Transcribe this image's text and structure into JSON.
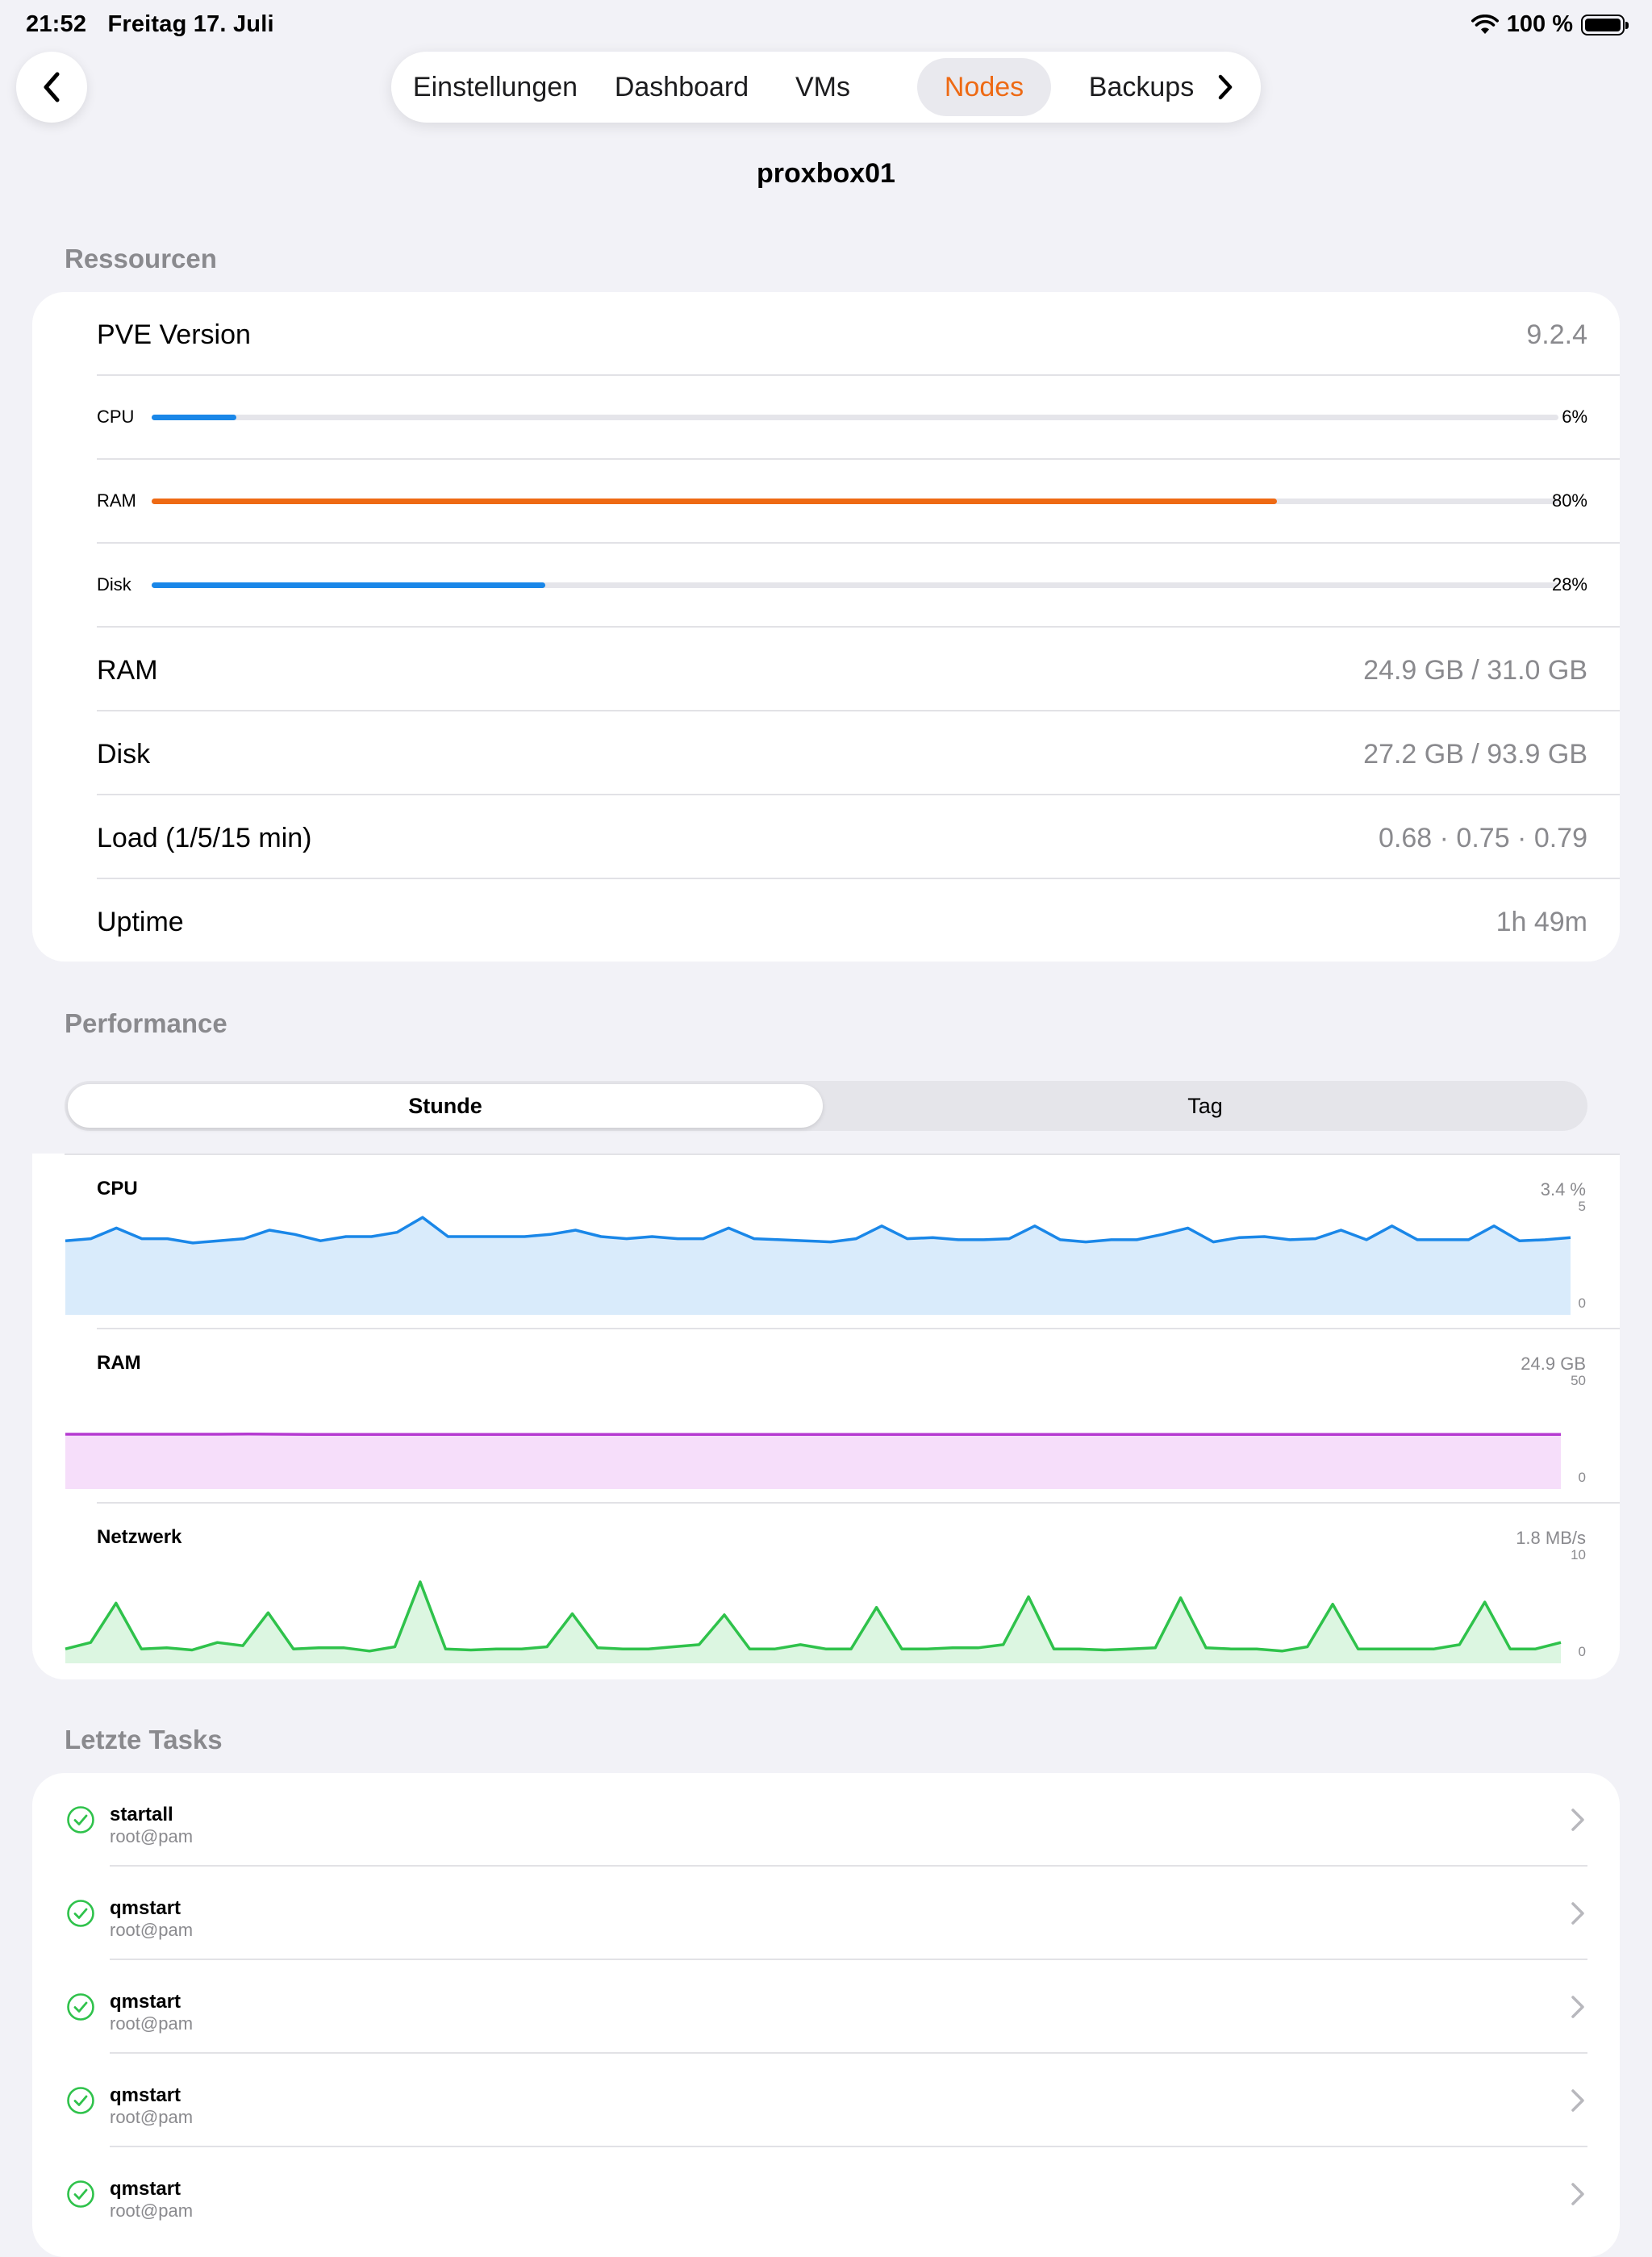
{
  "status": {
    "time": "21:52",
    "date": "Freitag 17. Juli",
    "battery": "100 %"
  },
  "tabs": [
    {
      "label": "Einstellungen",
      "active": false
    },
    {
      "label": "Dashboard",
      "active": false
    },
    {
      "label": "VMs",
      "active": false
    },
    {
      "label": "Nodes",
      "active": true
    },
    {
      "label": "Backups",
      "active": false
    }
  ],
  "colors": {
    "accent": "#ee6a14",
    "blue": "#1a87e8",
    "orange": "#ee6a14",
    "cpu_line": "#1a87e8",
    "ram_line": "#b53ad1",
    "net_line": "#2fc24b"
  },
  "node": {
    "title": "proxbox01"
  },
  "resources": {
    "header": "Ressourcen",
    "pve_label": "PVE Version",
    "pve_value": "9.2.4",
    "bars": [
      {
        "label": "CPU",
        "percent_text": "6%",
        "fraction": 0.06,
        "color": "blue"
      },
      {
        "label": "RAM",
        "percent_text": "80%",
        "fraction": 0.8,
        "color": "orange"
      },
      {
        "label": "Disk",
        "percent_text": "28%",
        "fraction": 0.28,
        "color": "blue"
      }
    ],
    "rows": [
      {
        "label": "RAM",
        "value": "24.9 GB / 31.0 GB"
      },
      {
        "label": "Disk",
        "value": "27.2 GB / 93.9 GB"
      },
      {
        "label": "Load (1/5/15 min)",
        "value": "0.68 · 0.75 · 0.79"
      },
      {
        "label": "Uptime",
        "value": "1h 49m"
      }
    ]
  },
  "performance": {
    "header": "Performance",
    "segments": [
      "Stunde",
      "Tag"
    ],
    "selected": "Stunde"
  },
  "chart_data": [
    {
      "type": "area",
      "title": "CPU",
      "current": "3.4 %",
      "ylim": [
        0,
        5
      ],
      "ytick_max": "5",
      "ytick_min": "0",
      "values": [
        3.4,
        3.5,
        4.0,
        3.5,
        3.5,
        3.3,
        3.4,
        3.5,
        3.9,
        3.7,
        3.4,
        3.6,
        3.6,
        3.8,
        4.5,
        3.6,
        3.6,
        3.6,
        3.6,
        3.7,
        3.9,
        3.6,
        3.5,
        3.6,
        3.5,
        3.5,
        4.0,
        3.5,
        3.45,
        3.4,
        3.35,
        3.5,
        4.1,
        3.5,
        3.55,
        3.45,
        3.45,
        3.5,
        4.1,
        3.45,
        3.35,
        3.45,
        3.45,
        3.7,
        4.0,
        3.35,
        3.55,
        3.6,
        3.45,
        3.5,
        3.9,
        3.45,
        4.1,
        3.45,
        3.45,
        3.45,
        4.1,
        3.4,
        3.45,
        3.55
      ]
    },
    {
      "type": "area",
      "title": "RAM",
      "current": "24.9 GB",
      "ylim": [
        0,
        50
      ],
      "ytick_max": "50",
      "ytick_min": "0",
      "values": [
        25.0,
        25.0,
        25.0,
        25.0,
        25.0,
        25.0,
        25.1,
        25.0,
        24.9,
        24.9,
        24.9,
        24.9,
        24.9,
        24.9,
        24.9,
        24.9,
        24.9,
        24.9,
        24.9,
        24.9,
        24.9,
        24.9,
        24.9,
        24.9,
        24.9,
        24.9,
        24.9,
        24.9,
        24.9,
        24.9,
        24.9,
        24.9,
        24.9,
        24.9,
        24.9,
        24.9,
        24.9,
        24.9,
        24.9,
        24.9,
        24.9,
        24.9,
        24.9,
        24.9,
        24.9,
        24.9,
        24.9,
        24.9,
        24.9,
        24.9
      ]
    },
    {
      "type": "area",
      "title": "Netzwerk",
      "current": "1.8 MB/s",
      "ylim": [
        0,
        10
      ],
      "ytick_max": "10",
      "ytick_min": "0",
      "values": [
        1.2,
        1.8,
        5.5,
        1.2,
        1.3,
        1.1,
        1.8,
        1.5,
        4.6,
        1.2,
        1.3,
        1.3,
        1.0,
        1.4,
        7.5,
        1.2,
        1.1,
        1.2,
        1.2,
        1.4,
        4.5,
        1.3,
        1.2,
        1.2,
        1.4,
        1.6,
        4.4,
        1.2,
        1.2,
        1.6,
        1.2,
        1.2,
        5.1,
        1.2,
        1.2,
        1.3,
        1.3,
        1.6,
        6.1,
        1.2,
        1.2,
        1.1,
        1.2,
        1.3,
        6.0,
        1.3,
        1.2,
        1.2,
        1.0,
        1.4,
        5.4,
        1.2,
        1.2,
        1.2,
        1.2,
        1.6,
        5.6,
        1.2,
        1.2,
        1.8
      ]
    }
  ],
  "tasks": {
    "header": "Letzte Tasks",
    "items": [
      {
        "name": "startall",
        "user": "root@pam"
      },
      {
        "name": "qmstart",
        "user": "root@pam"
      },
      {
        "name": "qmstart",
        "user": "root@pam"
      },
      {
        "name": "qmstart",
        "user": "root@pam"
      },
      {
        "name": "qmstart",
        "user": "root@pam"
      }
    ]
  }
}
